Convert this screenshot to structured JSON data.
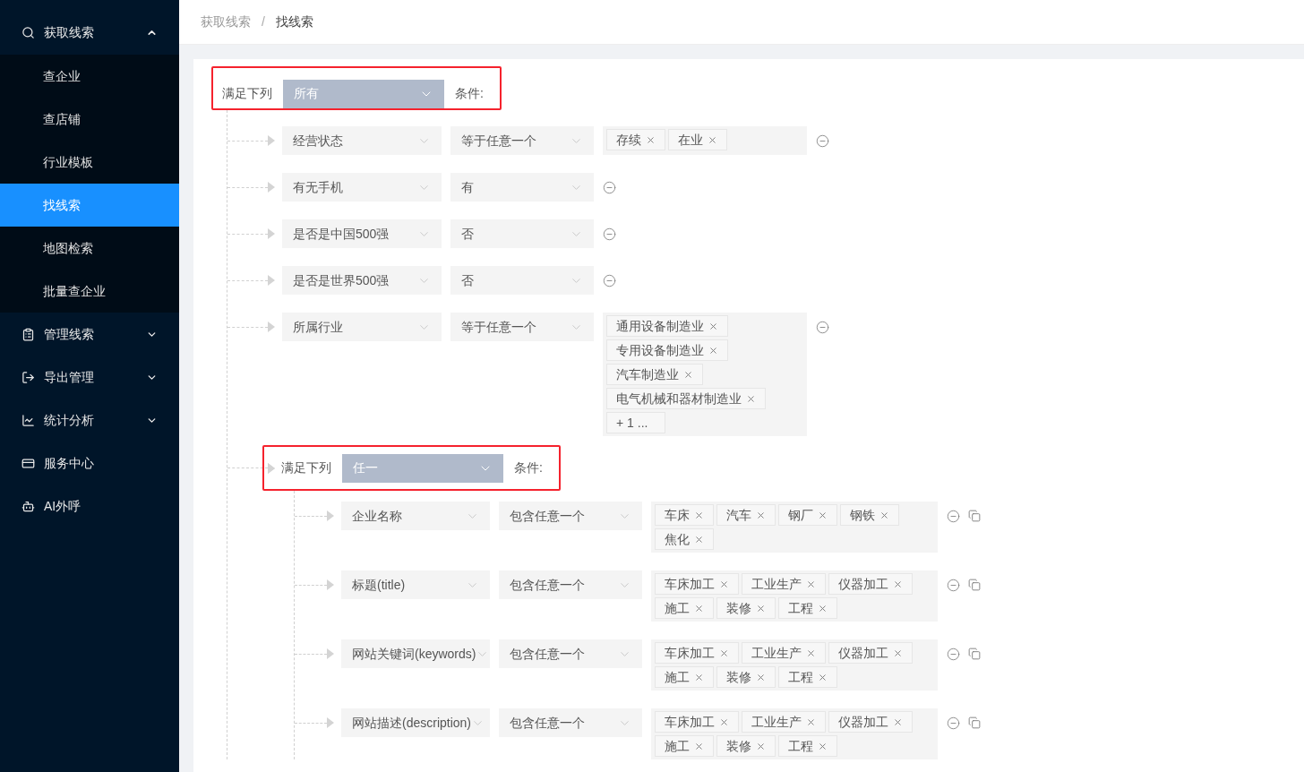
{
  "sidebar": {
    "items": [
      {
        "label": "获取线索",
        "expanded": true,
        "children": [
          {
            "label": "查企业",
            "selected": false
          },
          {
            "label": "查店铺",
            "selected": false
          },
          {
            "label": "行业模板",
            "selected": false
          },
          {
            "label": "找线索",
            "selected": true
          },
          {
            "label": "地图检索",
            "selected": false
          },
          {
            "label": "批量查企业",
            "selected": false
          }
        ]
      },
      {
        "label": "管理线索",
        "expanded": false
      },
      {
        "label": "导出管理",
        "expanded": false
      },
      {
        "label": "统计分析",
        "expanded": false
      },
      {
        "label": "服务中心"
      },
      {
        "label": "AI外呼"
      }
    ]
  },
  "breadcrumb": {
    "items": [
      "获取线索",
      "找线索"
    ],
    "separator": "/"
  },
  "filter": {
    "label": "满足下列",
    "match": "所有",
    "suffix": "条件:",
    "highlighted": true,
    "rules": [
      {
        "kind": "condition",
        "field": "经营状态",
        "operator": "等于任意一个",
        "values": [
          "存续",
          "在业"
        ]
      },
      {
        "kind": "condition",
        "field": "有无手机",
        "operator": "有"
      },
      {
        "kind": "condition",
        "field": "是否是中国500强",
        "operator": "否"
      },
      {
        "kind": "condition",
        "field": "是否是世界500强",
        "operator": "否"
      },
      {
        "kind": "condition",
        "field": "所属行业",
        "operator": "等于任意一个",
        "values": [
          "通用设备制造业",
          "专用设备制造业",
          "汽车制造业",
          "电气机械和器材制造业"
        ],
        "more": "+ 1 ..."
      },
      {
        "kind": "group",
        "label": "满足下列",
        "match": "任一",
        "suffix": "条件:",
        "highlighted": true,
        "rules": [
          {
            "kind": "condition",
            "field": "企业名称",
            "operator": "包含任意一个",
            "values": [
              "车床",
              "汽车",
              "钢厂",
              "钢铁",
              "焦化"
            ],
            "copyable": true
          },
          {
            "kind": "condition",
            "field": "标题(title)",
            "operator": "包含任意一个",
            "values": [
              "车床加工",
              "工业生产",
              "仪器加工",
              "施工",
              "装修",
              "工程"
            ],
            "copyable": true
          },
          {
            "kind": "condition",
            "field": "网站关键词(keywords)",
            "operator": "包含任意一个",
            "values": [
              "车床加工",
              "工业生产",
              "仪器加工",
              "施工",
              "装修",
              "工程"
            ],
            "copyable": true
          },
          {
            "kind": "condition",
            "field": "网站描述(description)",
            "operator": "包含任意一个",
            "values": [
              "车床加工",
              "工业生产",
              "仪器加工",
              "施工",
              "装修",
              "工程"
            ],
            "copyable": true
          }
        ]
      }
    ]
  }
}
